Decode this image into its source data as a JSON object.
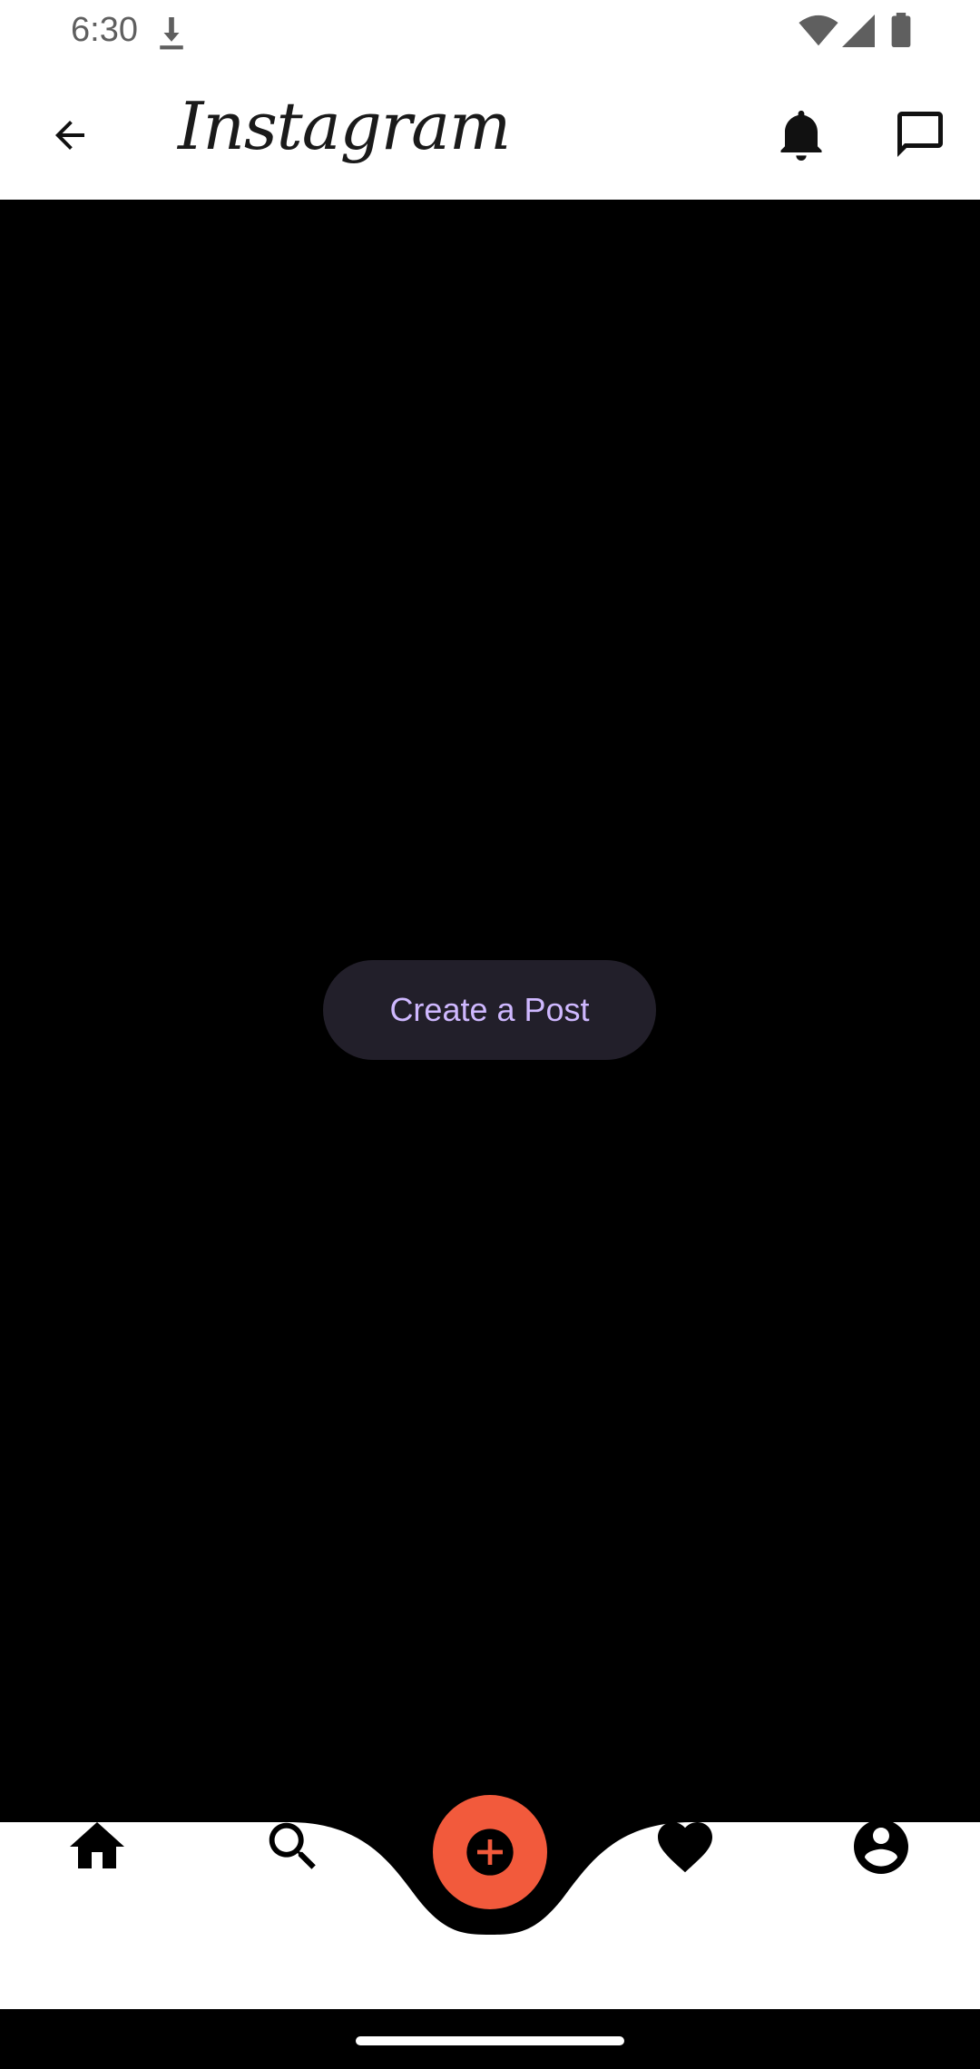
{
  "status_bar": {
    "time": "6:30",
    "icons": [
      "download-icon",
      "wifi-icon",
      "signal-icon",
      "battery-icon"
    ]
  },
  "app_bar": {
    "logo_text": "Instagram",
    "left_icon": "back-arrow-icon",
    "right_icons": [
      "notifications-bell-icon",
      "messages-chat-icon"
    ]
  },
  "main": {
    "create_post_label": "Create a Post"
  },
  "bottom_nav": {
    "items": [
      "home-icon",
      "search-icon",
      "add-post-icon",
      "heart-icon",
      "profile-icon"
    ]
  },
  "colors": {
    "background": "#000000",
    "bar_background": "#ffffff",
    "button_background": "#221f2a",
    "button_text": "#cfb8ff",
    "fab": "#f25a3c"
  }
}
